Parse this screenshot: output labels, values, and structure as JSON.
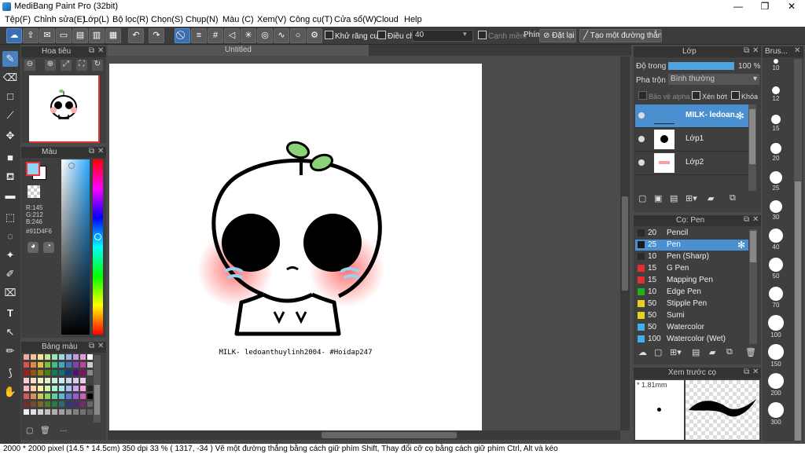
{
  "window": {
    "title": "MediBang Paint Pro (32bit)",
    "min": "—",
    "max": "❐",
    "close": "✕"
  },
  "menu": [
    "Tệp(F)",
    "Chỉnh sửa(E)",
    "Lớp(L)",
    "Bộ lọc(R)",
    "Chọn(S)",
    "Chụp(N)",
    "Màu (C)",
    "Xem(V)",
    "Công cụ(T)",
    "Cửa sổ(W)",
    "Cloud",
    "Help"
  ],
  "toolbar": {
    "antialias": "Khử răng cưa",
    "adjust": "Điều chỉnh",
    "adjust_value": "40",
    "edge": "Cạnh mềm",
    "key": "Phím",
    "reset": "Đặt lại",
    "straight": "Tạo một đường thẳng"
  },
  "navigator": {
    "title": "Hoa tiêu"
  },
  "color_panel": {
    "title": "Màu",
    "r": "R:145",
    "g": "G:212",
    "b": "B:246",
    "hex": "#91D4F6"
  },
  "palette_panel": {
    "title": "Bảng màu",
    "footer": "---"
  },
  "canvas": {
    "tab": "Untitled",
    "caption": "MILK- ledoanthuylinh2004- #Hoidap247"
  },
  "layer_panel": {
    "title": "Lớp",
    "opacity_label": "Độ trong",
    "opacity_value": "100 %",
    "blend_label": "Pha trộn",
    "blend_value": "Bình thường",
    "protect_alpha": "Bảo vệ alpha",
    "clip": "Xén bớt",
    "lock": "Khóa",
    "layers": [
      {
        "name": "MILK- ledoan..."
      },
      {
        "name": "Lớp1"
      },
      {
        "name": "Lớp2"
      }
    ]
  },
  "brush_panel": {
    "title": "Cọ: Pen",
    "brushes": [
      {
        "size": "20",
        "name": "Pencil",
        "color": "#2a2a2a"
      },
      {
        "size": "25",
        "name": "Pen",
        "color": "#1a1a1a",
        "selected": true
      },
      {
        "size": "10",
        "name": "Pen (Sharp)",
        "color": "#2a2a2a"
      },
      {
        "size": "15",
        "name": "G Pen",
        "color": "#e03030"
      },
      {
        "size": "15",
        "name": "Mapping Pen",
        "color": "#e03030"
      },
      {
        "size": "10",
        "name": "Edge Pen",
        "color": "#20b020"
      },
      {
        "size": "50",
        "name": "Stipple Pen",
        "color": "#e8d020"
      },
      {
        "size": "50",
        "name": "Sumi",
        "color": "#e8d020"
      },
      {
        "size": "50",
        "name": "Watercolor",
        "color": "#40b0e8"
      },
      {
        "size": "100",
        "name": "Watercolor (Wet)",
        "color": "#40b0e8"
      }
    ]
  },
  "preview_panel": {
    "title": "Xem trước cọ",
    "size": "1.81mm"
  },
  "brush_size_panel": {
    "title": "Brus...",
    "sizes": [
      "10",
      "12",
      "15",
      "20",
      "25",
      "30",
      "40",
      "50",
      "70",
      "100",
      "150",
      "200",
      "300"
    ]
  },
  "status": "2000 * 2000 pixel   (14.5 * 14.5cm)   350 dpi   33 %   ( 1317, -34 )   Vẽ một đường thẳng bằng cách giữ phím Shift, Thay đổi cỡ cọ bằng cách giữ phím Ctrl, Alt và kéo"
}
